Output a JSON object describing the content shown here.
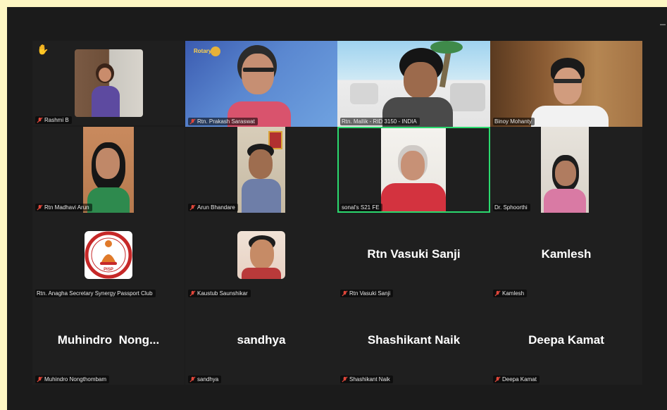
{
  "participants": [
    {
      "name": "Rashmi B",
      "mode": "video"
    },
    {
      "name": "Rtn. Prakash Saraswat",
      "mode": "video"
    },
    {
      "name": "Rtn. Mallik - RID 3150 - INDIA",
      "mode": "video"
    },
    {
      "name": "Binoy Mohanty",
      "mode": "video"
    },
    {
      "name": "Rtn Madhavi Arun",
      "mode": "video"
    },
    {
      "name": "Arun Bhandare",
      "mode": "video"
    },
    {
      "name": "sonal's S21 FE",
      "mode": "video",
      "active_speaker": true
    },
    {
      "name": "Dr. Sphoorthi",
      "mode": "video"
    },
    {
      "name": "Rtn. Anagha Secretary Synergy Passport Club",
      "mode": "avatar"
    },
    {
      "name": "Kaustub Saunshikar",
      "mode": "avatar"
    },
    {
      "name": "Rtn Vasuki Sanji",
      "display": "Rtn Vasuki Sanji",
      "mode": "name"
    },
    {
      "name": "Kamlesh",
      "display": "Kamlesh",
      "mode": "name"
    },
    {
      "name": "Muhindro Nongthombam",
      "display": "Muhindro  Nong...",
      "mode": "name"
    },
    {
      "name": "sandhya",
      "display": "sandhya",
      "mode": "name"
    },
    {
      "name": "Shashikant Naik",
      "display": "Shashikant Naik",
      "mode": "name"
    },
    {
      "name": "Deepa Kamat",
      "display": "Deepa Kamat",
      "mode": "name"
    }
  ],
  "logo_text": "PISP",
  "colors": {
    "outer_background": "#fdf6c3",
    "gallery_background": "#1b1b1b",
    "tile_background": "#1f1f1f",
    "active_speaker_border": "#2bd96e",
    "muted_mic": "#e0463a",
    "raise_hand": "#f5b73b"
  },
  "icons": {
    "raise_hand": "raised-hand-icon",
    "muted": "muted-mic-icon"
  }
}
